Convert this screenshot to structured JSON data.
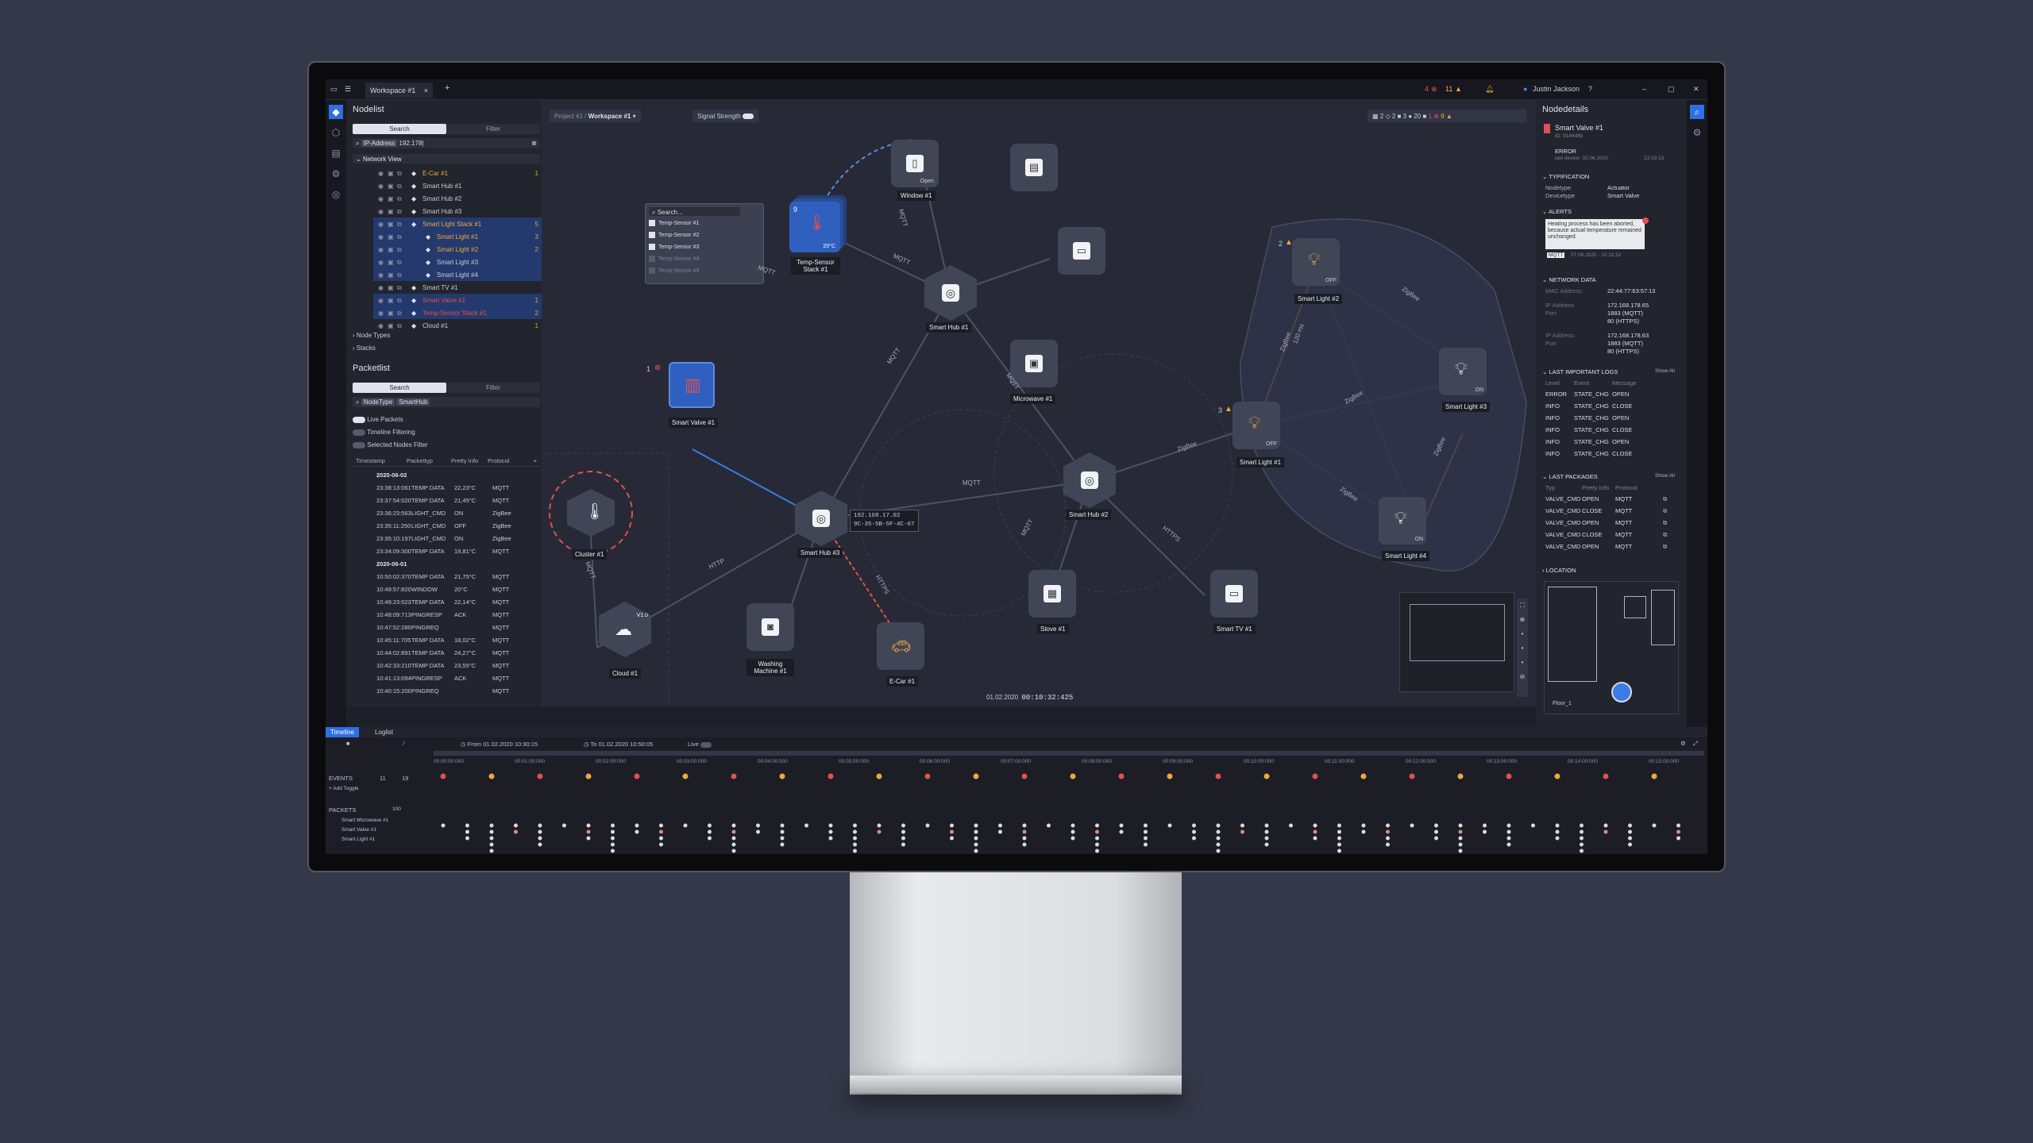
{
  "window": {
    "tab_label": "Workspace #1",
    "tab_close": "×",
    "add_tab": "+",
    "alerts_err": "4",
    "alerts_warn": "11",
    "user": "Justin Jackson",
    "help": "?",
    "min": "–",
    "max": "▢",
    "close": "✕"
  },
  "nodelist": {
    "title": "Nodelist",
    "search": "Search",
    "filter": "Filter",
    "ip_select": "IP-Address",
    "ip_value": "192.178|",
    "network_view": "Network View",
    "node_types": "Node Types",
    "stacks": "Stacks",
    "items": [
      {
        "label": "E-Car #1",
        "count": "1",
        "alert": "warn",
        "sel": false,
        "style": "orange"
      },
      {
        "label": "Smart Hub #1",
        "count": "",
        "alert": "",
        "sel": false,
        "style": ""
      },
      {
        "label": "Smart Hub #2",
        "count": "",
        "alert": "",
        "sel": false,
        "style": ""
      },
      {
        "label": "Smart Hub #3",
        "count": "",
        "alert": "",
        "sel": false,
        "style": ""
      },
      {
        "label": "Smart Light Stack #1",
        "count": "5",
        "alert": "warn",
        "sel": true,
        "style": "orange"
      },
      {
        "label": "Smart Light #1",
        "count": "3",
        "alert": "warn",
        "sel": true,
        "style": "orange"
      },
      {
        "label": "Smart Light #2",
        "count": "2",
        "alert": "warn",
        "sel": true,
        "style": "orange"
      },
      {
        "label": "Smart Light #3",
        "count": "",
        "alert": "",
        "sel": true,
        "style": ""
      },
      {
        "label": "Smart Light #4",
        "count": "",
        "alert": "",
        "sel": true,
        "style": ""
      },
      {
        "label": "Smart TV #1",
        "count": "",
        "alert": "",
        "sel": false,
        "style": ""
      },
      {
        "label": "Smart Valve #1",
        "count": "1",
        "alert": "err",
        "sel": true,
        "style": "red"
      },
      {
        "label": "Temp-Sensor Stack #1",
        "count": "2",
        "alert": "both",
        "sel": true,
        "style": "red"
      },
      {
        "label": "Cloud #1",
        "count": "1",
        "alert": "both",
        "sel": false,
        "style": ""
      }
    ]
  },
  "packetlist": {
    "title": "Packetlist",
    "search": "Search",
    "filter": "Filter",
    "type_select": "NodeType",
    "type_value": "SmartHub",
    "live": "Live Packets",
    "timeline_filter": "Timeline Filtering",
    "selected_filter": "Selected Nodes Filter",
    "headers": [
      "Timestamp",
      "Packettyp",
      "Pretty Info",
      "Protocol"
    ],
    "rows": [
      {
        "d": "2020-06-02"
      },
      {
        "t": "23:38:13:061",
        "type": "TEMP DATA",
        "info": "22,23°C",
        "proto": "MQTT"
      },
      {
        "t": "23:37:54:020",
        "type": "TEMP DATA",
        "info": "21,45°C",
        "proto": "MQTT"
      },
      {
        "t": "23:36:23:563",
        "type": "LIGHT_CMD",
        "info": "ON",
        "proto": "ZigBee"
      },
      {
        "t": "23:35:11:250",
        "type": "LIGHT_CMD",
        "info": "OFF",
        "proto": "ZigBee"
      },
      {
        "t": "23:35:10:197",
        "type": "LIGHT_CMD",
        "info": "ON",
        "proto": "ZigBee"
      },
      {
        "t": "23:34:09:300",
        "type": "TEMP DATA",
        "info": "19,81°C",
        "proto": "MQTT"
      },
      {
        "d": "2020-06-01"
      },
      {
        "t": "10:50:02:370",
        "type": "TEMP DATA",
        "info": "21,75°C",
        "proto": "MQTT"
      },
      {
        "t": "10:49:57:820",
        "type": "WINDOW",
        "info": "20°C",
        "proto": "MQTT"
      },
      {
        "t": "10:49:23:023",
        "type": "TEMP DATA",
        "info": "22,14°C",
        "proto": "MQTT"
      },
      {
        "t": "10:48:09:713",
        "type": "PINGRESP",
        "info": "ACK",
        "proto": "MQTT"
      },
      {
        "t": "10:47:52:280",
        "type": "PINGREQ",
        "info": "",
        "proto": "MQTT"
      },
      {
        "t": "10:45:11:705",
        "type": "TEMP DATA",
        "info": "18,02°C",
        "proto": "MQTT"
      },
      {
        "t": "10:44:02:891",
        "type": "TEMP DATA",
        "info": "24,27°C",
        "proto": "MQTT"
      },
      {
        "t": "10:42:33:210",
        "type": "TEMP DATA",
        "info": "23,55°C",
        "proto": "MQTT"
      },
      {
        "t": "10:41:13:094",
        "type": "PINGRESP",
        "info": "ACK",
        "proto": "MQTT"
      },
      {
        "t": "10:40:15:200",
        "type": "PINGREQ",
        "info": "",
        "proto": "MQTT"
      }
    ]
  },
  "canvas": {
    "breadcrumb_project": "Project #1 /",
    "breadcrumb_ws": "Workspace #1",
    "signal": "Signal Strength",
    "counts": [
      "2",
      "2",
      "3",
      "20",
      "1",
      "9"
    ],
    "nodes": {
      "window": "Window #1",
      "window_state": "Open",
      "hub1": "Smart Hub #1",
      "hub2": "Smart Hub #2",
      "hub3": "Smart Hub #3",
      "valve": "Smart Valve #1",
      "temp": "Temp-Sensor Stack #1",
      "temp_val": "20°C",
      "temp_count": "9",
      "cluster": "Cluster #1",
      "cloud": "Cloud #1",
      "cloud_ver": "V1.0",
      "washer": "Washing Machine #1",
      "ecar": "E-Car #1",
      "stove": "Stove #1",
      "micro": "Microwave #1",
      "tv": "Smart TV #1",
      "l1": "Smart Light #1",
      "l2": "Smart Light #2",
      "l3": "Smart Light #3",
      "l4": "Smart Light #4",
      "off": "OFF",
      "on": "ON",
      "ip": "192.168.17.02",
      "mac": "9C-35-5B-5F-4C-07",
      "valve_badge": "1",
      "l1_badge": "3",
      "l2_badge": "2"
    },
    "edges": [
      "MQTT",
      "MQTT",
      "MQTT",
      "MQTT",
      "MQTT",
      "MQTT",
      "MQTT",
      "HTTP",
      "HTTPS",
      "HTTPS",
      "ZigBee",
      "ZigBee",
      "ZigBee",
      "ZigBee",
      "ZigBee",
      "ZigBee",
      "MQTT",
      "120 ms"
    ],
    "popup_search": "Search...",
    "popup_items": [
      "Temp-Sensor #1",
      "Temp-Sensor #2",
      "Temp-Sensor #3",
      "Temp-Sensor #4",
      "Temp-Sensor #5"
    ],
    "time_date": "01.02.2020",
    "time_clock": "00:10:32:425"
  },
  "details": {
    "title": "Nodedetails",
    "name": "Smart Valve #1",
    "id": "ID: 9184d8b",
    "status": "ERROR",
    "last": "last device: 02.06.2020",
    "last_t": "23:33:13",
    "typification": "TYPIFICATION",
    "nodetype_k": "Nodetype",
    "nodetype_v": "Actuator",
    "devtype_k": "Devicetype",
    "devtype_v": "Smart Valve",
    "alerts": "ALERTS",
    "alert_msg": "Heating process has been aborted, because actual temperature remained unchanged.",
    "alert_proto": "MQTT",
    "alert_time": "07.06.2020 · 10:31:52",
    "network": "NETWORK DATA",
    "mac_k": "MAC Address",
    "mac_v": "22:44:77:63:57:13",
    "ip1_k": "IP Address",
    "ip1_v": "172.168.178.65",
    "port1_k": "Port",
    "port1_a": "1883 (MQTT)",
    "port1_b": "80 (HTTPS)",
    "ip2_k": "IP Address",
    "ip2_v": "172.168.178.63",
    "port2_k": "Port",
    "port2_a": "1883 (MQTT)",
    "port2_b": "80 (HTTPS)",
    "logs": "LAST IMPORTANT LOGS",
    "show_all": "Show All",
    "log_headers": [
      "Level",
      "Event",
      "Message"
    ],
    "log_rows": [
      [
        "ERROR",
        "STATE_CHG",
        "OPEN"
      ],
      [
        "INFO",
        "STATE_CHG",
        "CLOSE"
      ],
      [
        "INFO",
        "STATE_CHG",
        "OPEN"
      ],
      [
        "INFO",
        "STATE_CHG",
        "CLOSE"
      ],
      [
        "INFO",
        "STATE_CHG",
        "OPEN"
      ],
      [
        "INFO",
        "STATE_CHG",
        "CLOSE"
      ]
    ],
    "pkgs": "LAST PACKAGES",
    "pkg_headers": [
      "Typ",
      "Pretty Info",
      "Protocol"
    ],
    "pkg_rows": [
      [
        "VALVE_CMD",
        "OPEN",
        "MQTT"
      ],
      [
        "VALVE_CMD",
        "CLOSE",
        "MQTT"
      ],
      [
        "VALVE_CMD",
        "OPEN",
        "MQTT"
      ],
      [
        "VALVE_CMD",
        "CLOSE",
        "MQTT"
      ],
      [
        "VALVE_CMD",
        "OPEN",
        "MQTT"
      ]
    ],
    "location": "LOCATION",
    "floor": "Floor_1"
  },
  "timeline": {
    "tab1": "Timeline",
    "tab2": "Loglist",
    "from_k": "From",
    "from_v": "01.02.2020",
    "from_t": "10:30:15",
    "to_k": "To",
    "to_v": "01.02.2020",
    "to_t": "10:50:05",
    "live": "Live",
    "events": "EVENTS",
    "ev_err": "11",
    "ev_warn": "19",
    "add_toggle": "+ Add Toggle",
    "packets": "PACKETS",
    "pk_count": "100",
    "pk_items": [
      "Smart Microwave #1",
      "Smart Valve #1",
      "Smart Light #1"
    ],
    "ticks": [
      "00:00:00:000",
      "00:01:00:000",
      "00:02:00:000",
      "00:03:00:000",
      "00:04:00:000",
      "00:05:00:000",
      "00:06:00:000",
      "00:07:00:000",
      "00:08:00:000",
      "00:09:00:000",
      "00:10:00:000",
      "00:11:00:000",
      "00:12:00:000",
      "00:13:00:000",
      "00:14:00:000",
      "00:15:00:000"
    ]
  }
}
